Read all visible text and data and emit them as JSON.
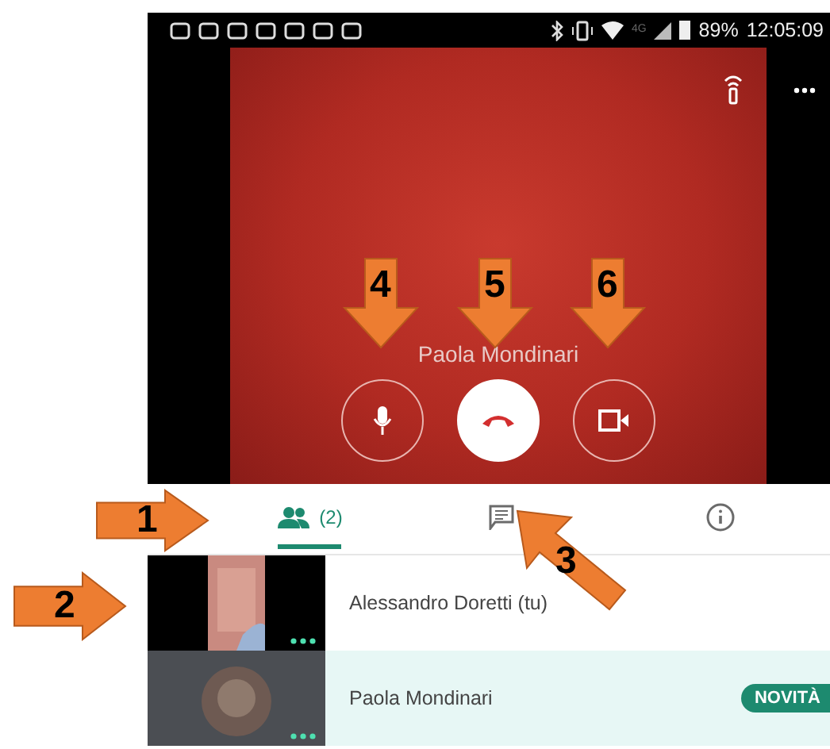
{
  "status_bar": {
    "network": "4G",
    "battery": "89%",
    "time": "12:05:09"
  },
  "call": {
    "caller_name": "Paola Mondinari",
    "controls": [
      {
        "kind": "mic"
      },
      {
        "kind": "hangup"
      },
      {
        "kind": "camera"
      }
    ]
  },
  "tabs": [
    {
      "kind": "people",
      "label": "(2)",
      "selected": true
    },
    {
      "kind": "chat",
      "selected": false
    },
    {
      "kind": "info",
      "selected": false
    }
  ],
  "participants": [
    {
      "name": "Alessandro Doretti (tu)",
      "highlighted": false
    },
    {
      "name": "Paola Mondinari",
      "highlighted": true,
      "badge": "NOVITÀ"
    }
  ],
  "annotations": [
    {
      "number": "1",
      "kind": "right"
    },
    {
      "number": "2",
      "kind": "right"
    },
    {
      "number": "3",
      "kind": "up-left"
    },
    {
      "number": "4",
      "kind": "down"
    },
    {
      "number": "5",
      "kind": "down"
    },
    {
      "number": "6",
      "kind": "down"
    }
  ]
}
